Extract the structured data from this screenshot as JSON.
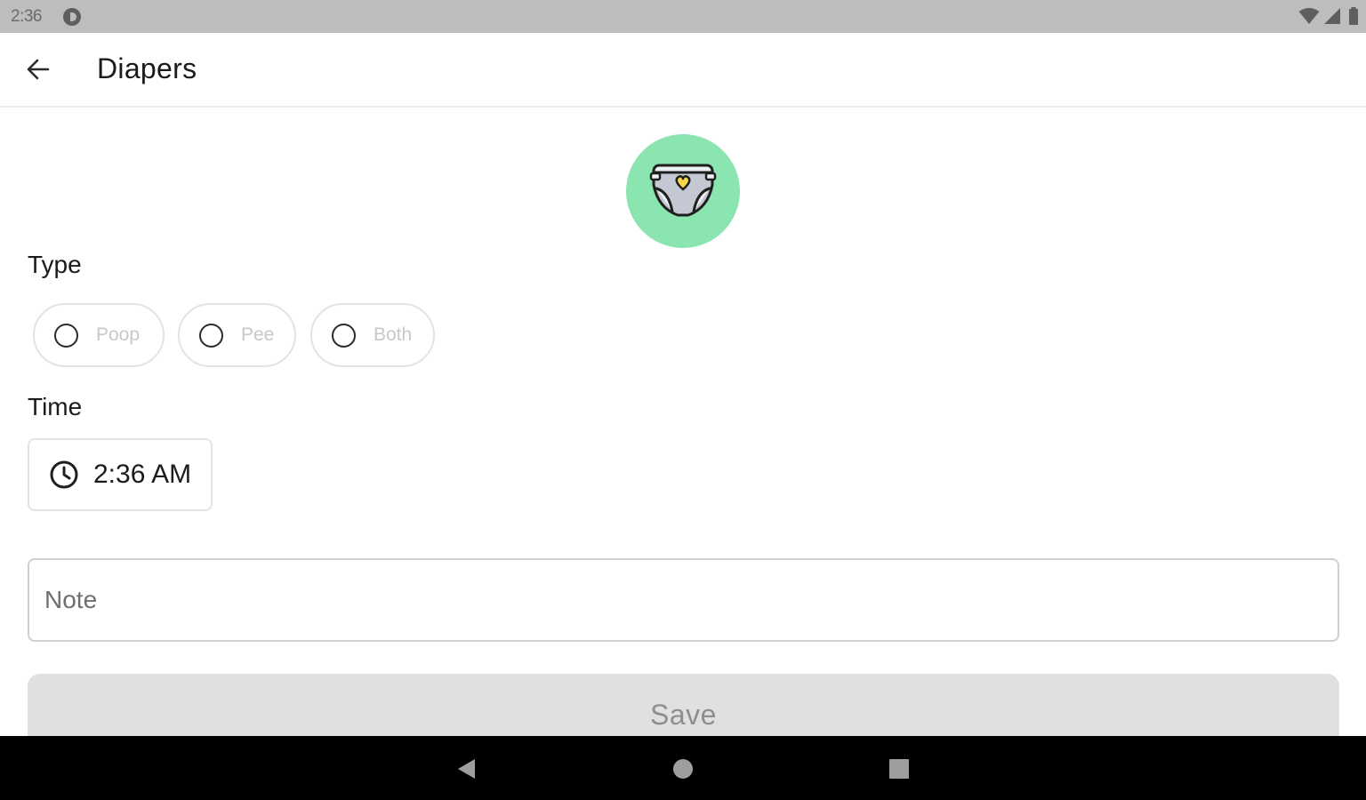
{
  "status_bar": {
    "time": "2:36",
    "icons": [
      "app-notification-icon",
      "wifi-icon",
      "signal-icon",
      "battery-icon"
    ]
  },
  "app_bar": {
    "back_icon": "arrow-left-icon",
    "title": "Diapers"
  },
  "hero": {
    "icon": "diaper-icon",
    "background_color": "#8ae5b0"
  },
  "type_section": {
    "label": "Type",
    "options": [
      {
        "label": "Poop",
        "selected": false
      },
      {
        "label": "Pee",
        "selected": false
      },
      {
        "label": "Both",
        "selected": false
      }
    ]
  },
  "time_section": {
    "label": "Time",
    "icon": "clock-icon",
    "value": "2:36 AM"
  },
  "note": {
    "placeholder": "Note",
    "value": ""
  },
  "save": {
    "label": "Save",
    "enabled": false
  },
  "nav_bar": {
    "buttons": [
      "back-triangle-icon",
      "home-circle-icon",
      "recents-square-icon"
    ]
  }
}
